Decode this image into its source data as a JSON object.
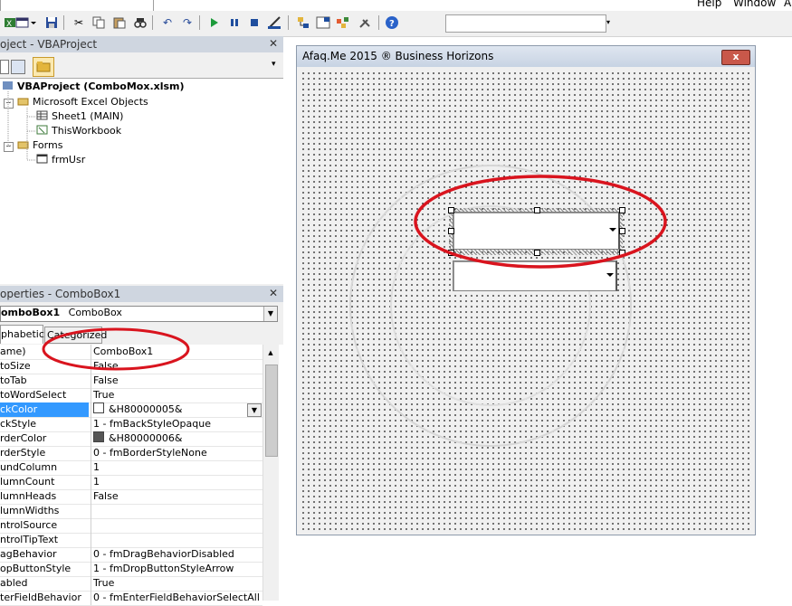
{
  "menubar": {
    "combo_text": "...",
    "help": "Help",
    "window": "Window",
    "trailing": "A"
  },
  "toolbar": {
    "icons": [
      "view-excel-icon",
      "insert-userform-icon",
      "save-icon",
      "cut-icon",
      "copy-icon",
      "paste-icon",
      "find-icon",
      "undo-icon",
      "redo-icon",
      "run-icon",
      "break-icon",
      "reset-icon",
      "design-mode-icon",
      "project-explorer-icon",
      "properties-icon",
      "object-browser-icon",
      "toolbox-icon",
      "help-icon"
    ]
  },
  "project_panel": {
    "title": "oject - VBAProject",
    "tree": [
      {
        "label": "VBAProject (ComboMox.xlsm)",
        "bold": true
      },
      {
        "label": "Microsoft Excel Objects"
      },
      {
        "label": "Sheet1 (MAIN)"
      },
      {
        "label": "ThisWorkbook"
      },
      {
        "label": "Forms"
      },
      {
        "label": "frmUsr"
      }
    ]
  },
  "properties_panel": {
    "title": "operties - ComboBox1",
    "object_name": "omboBox1",
    "object_type": "ComboBox",
    "tabs": [
      "phabetic",
      "Categorized"
    ],
    "rows": [
      {
        "name": "ame)",
        "value": "ComboBox1"
      },
      {
        "name": "toSize",
        "value": "False"
      },
      {
        "name": "toTab",
        "value": "False"
      },
      {
        "name": "toWordSelect",
        "value": "True"
      },
      {
        "name": "ckColor",
        "value": "&H80000005&",
        "swatch": "#ffffff",
        "selected": true
      },
      {
        "name": "ckStyle",
        "value": "1 - fmBackStyleOpaque"
      },
      {
        "name": "rderColor",
        "value": "&H80000006&",
        "swatch": "#555555"
      },
      {
        "name": "rderStyle",
        "value": "0 - fmBorderStyleNone"
      },
      {
        "name": "undColumn",
        "value": "1"
      },
      {
        "name": "lumnCount",
        "value": "1"
      },
      {
        "name": "lumnHeads",
        "value": "False"
      },
      {
        "name": "lumnWidths",
        "value": ""
      },
      {
        "name": "ntrolSource",
        "value": ""
      },
      {
        "name": "ntrolTipText",
        "value": ""
      },
      {
        "name": "agBehavior",
        "value": "0 - fmDragBehaviorDisabled"
      },
      {
        "name": "opButtonStyle",
        "value": "1 - fmDropButtonStyleArrow"
      },
      {
        "name": "abled",
        "value": "True"
      },
      {
        "name": "terFieldBehavior",
        "value": "0 - fmEnterFieldBehaviorSelectAll"
      }
    ]
  },
  "userform": {
    "title": "Afaq.Me 2015 ® Business Horizons",
    "close_label": "x"
  },
  "colors": {
    "selection": "#3399ff",
    "annotation": "#d9141e"
  }
}
